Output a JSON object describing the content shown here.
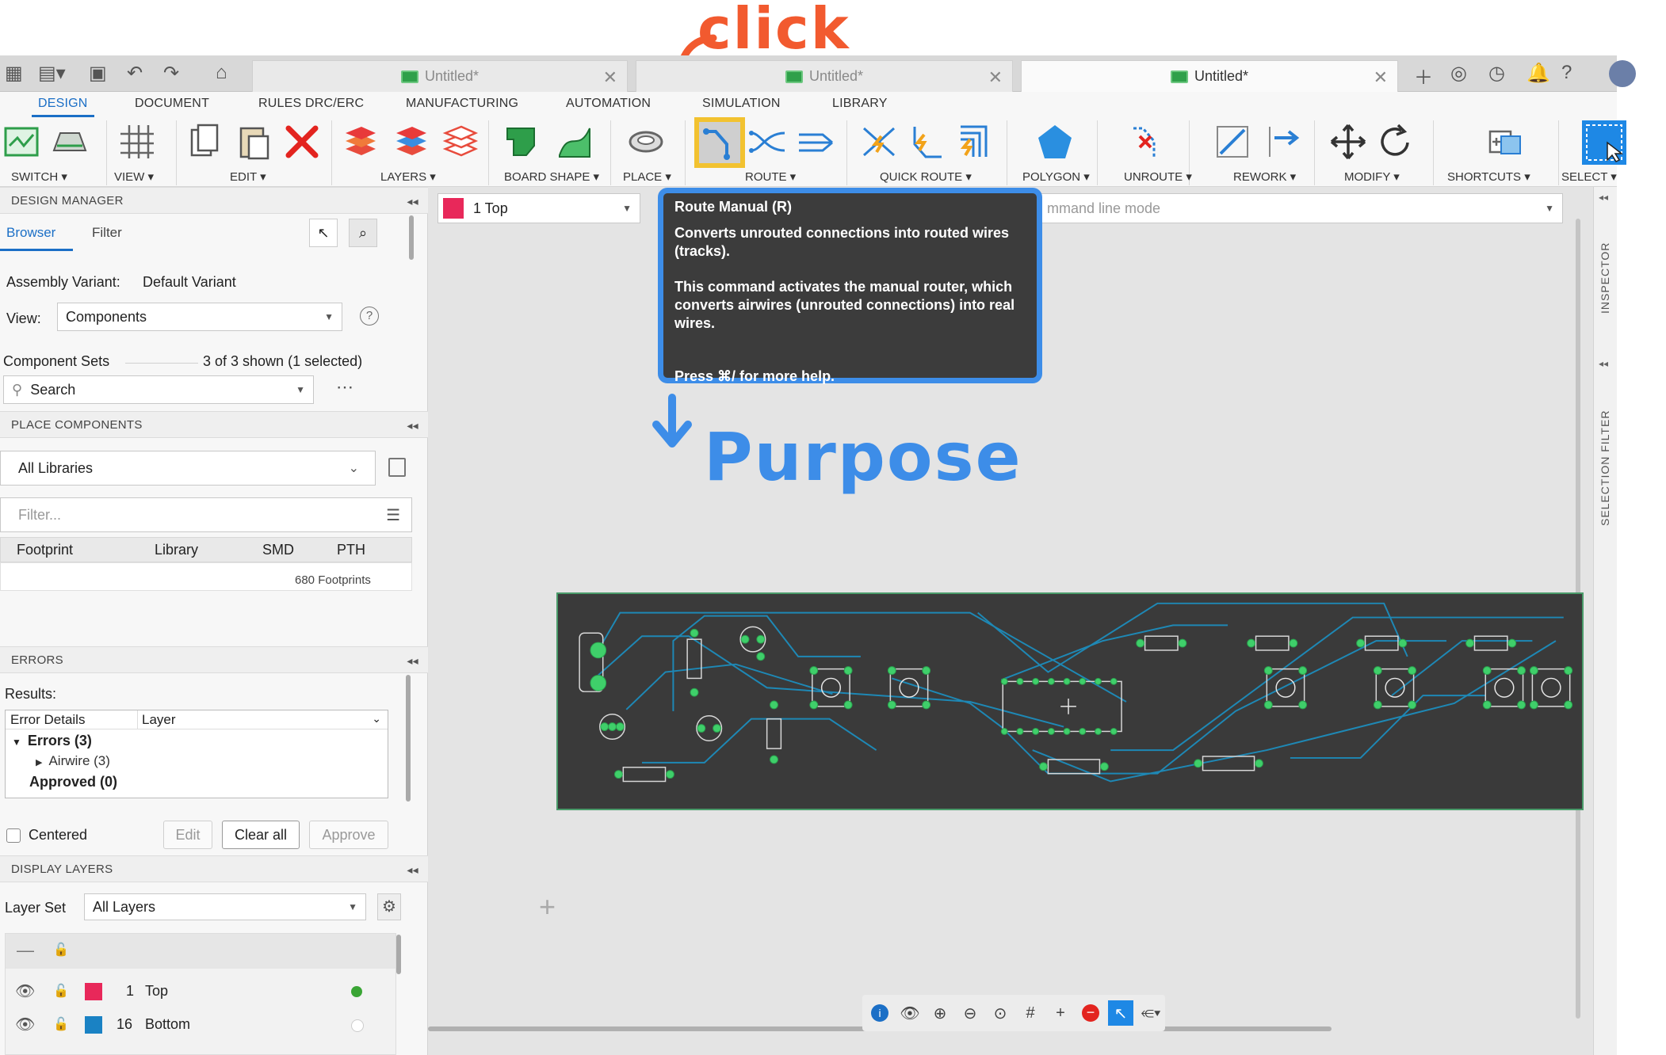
{
  "annotations": {
    "click": "click",
    "purpose": "Purpose"
  },
  "doc_tabs": [
    {
      "label": "Untitled*",
      "active": false
    },
    {
      "label": "Untitled*",
      "active": false
    },
    {
      "label": "Untitled*",
      "active": true
    }
  ],
  "ribbon_tabs": [
    "DESIGN",
    "DOCUMENT",
    "RULES DRC/ERC",
    "MANUFACTURING",
    "AUTOMATION",
    "SIMULATION",
    "LIBRARY"
  ],
  "ribbon_groups": [
    "SWITCH ▾",
    "VIEW ▾",
    "EDIT ▾",
    "LAYERS ▾",
    "BOARD SHAPE ▾",
    "PLACE ▾",
    "ROUTE ▾",
    "QUICK ROUTE ▾",
    "POLYGON ▾",
    "UNROUTE ▾",
    "REWORK ▾",
    "MODIFY ▾",
    "SHORTCUTS ▾",
    "SELECT ▾"
  ],
  "design_manager": {
    "header": "DESIGN MANAGER",
    "tabs": [
      "Browser",
      "Filter"
    ],
    "assembly_variant_label": "Assembly Variant:",
    "assembly_variant_value": "Default Variant",
    "view_label": "View:",
    "view_value": "Components",
    "component_sets_label": "Component Sets",
    "component_sets_count": "3 of 3 shown (1 selected)",
    "search_placeholder": "Search"
  },
  "place_components": {
    "header": "PLACE COMPONENTS",
    "library_value": "All Libraries",
    "filter_placeholder": "Filter...",
    "columns": [
      "Footprint",
      "Library",
      "SMD",
      "PTH"
    ],
    "footprint_count": "680 Footprints"
  },
  "errors": {
    "header": "ERRORS",
    "results_label": "Results:",
    "columns": [
      "Error Details",
      "Layer"
    ],
    "errors_node": "Errors (3)",
    "airwire_node": "Airwire (3)",
    "approved_node": "Approved (0)",
    "centered_label": "Centered",
    "edit_button": "Edit",
    "clear_all_button": "Clear all",
    "approve_button": "Approve"
  },
  "display_layers": {
    "header": "DISPLAY LAYERS",
    "layer_set_label": "Layer Set",
    "layer_set_value": "All Layers",
    "layers": [
      {
        "num": "1",
        "name": "Top",
        "color": "#e8285a"
      },
      {
        "num": "16",
        "name": "Bottom",
        "color": "#1a82c4"
      }
    ]
  },
  "layer_select": {
    "value": "1 Top",
    "color": "#e8285a"
  },
  "command_line_placeholder": "mmand line mode",
  "tooltip": {
    "title": "Route Manual (R)",
    "line1": "Converts unrouted connections into routed wires (tracks).",
    "line2": "This command activates the manual router, which converts airwires (unrouted connections) into real wires.",
    "line3": "Press ⌘/ for more help."
  },
  "right_strip": {
    "inspector": "INSPECTOR",
    "selection_filter": "SELECTION FILTER"
  },
  "colors": {
    "accent": "#1b6fc6",
    "tooltip_border": "#3d8de8",
    "highlight": "#f2c230",
    "pcb_bg": "#3a3a3a",
    "trace": "#1e88b5",
    "pad": "#3fcf6a"
  }
}
